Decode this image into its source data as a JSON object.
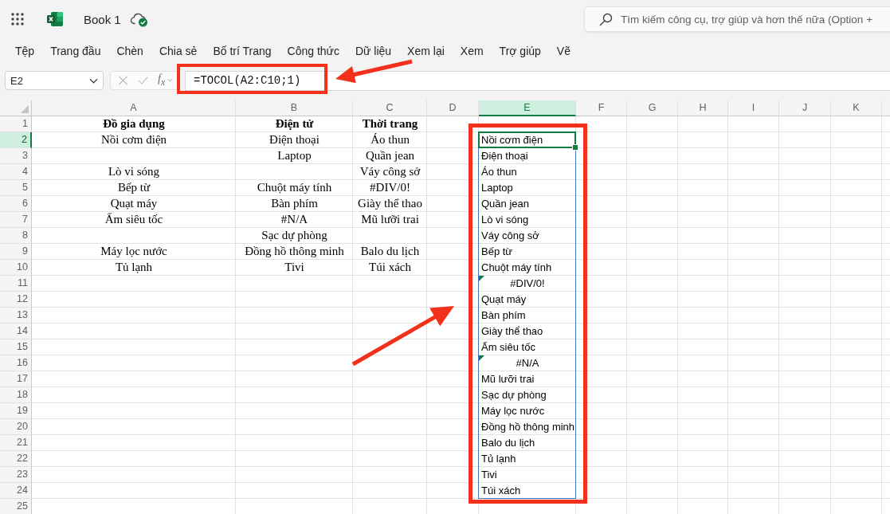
{
  "app_bar": {
    "title": "Book 1"
  },
  "search": {
    "placeholder": "Tìm kiếm công cụ, trợ giúp và hơn thế nữa (Option +"
  },
  "menu": [
    "Tệp",
    "Trang đầu",
    "Chèn",
    "Chia sẻ",
    "Bố trí Trang",
    "Công thức",
    "Dữ liệu",
    "Xem lại",
    "Xem",
    "Trợ giúp",
    "Vẽ"
  ],
  "formula_bar": {
    "cell_reference": "E2",
    "function_button": "f$_{x}$",
    "formula": "=TOCOL(A2:C10;1)",
    "highlighted": true
  },
  "sheet": {
    "columns": [
      {
        "label": "A",
        "selected": false,
        "highlighted": false
      },
      {
        "label": "B",
        "selected": false,
        "highlighted": false
      },
      {
        "label": "C",
        "selected": false,
        "highlighted": false
      },
      {
        "label": "D",
        "selected": false,
        "highlighted": false
      },
      {
        "label": "E",
        "selected": true,
        "highlighted": true
      },
      {
        "label": "F",
        "selected": false,
        "highlighted": false
      },
      {
        "label": "G",
        "selected": false,
        "highlighted": false
      },
      {
        "label": "H",
        "selected": false,
        "highlighted": false
      },
      {
        "label": "I",
        "selected": false,
        "highlighted": false
      },
      {
        "label": "J",
        "selected": false,
        "highlighted": false
      },
      {
        "label": "K",
        "selected": false,
        "highlighted": false
      }
    ],
    "rows": [
      {
        "number": "1",
        "selected": false,
        "cells": {
          "a": {
            "text": "Đồ gia dụng",
            "kind": "heading",
            "selected": false
          },
          "b": {
            "text": "Điện tử",
            "kind": "heading",
            "selected": false
          },
          "c": {
            "text": "Thời trang",
            "kind": "heading",
            "selected": false
          }
        }
      },
      {
        "number": "2",
        "selected": true,
        "cells": {
          "a": {
            "text": "Nồi cơm điện",
            "kind": "value",
            "selected": false
          },
          "b": {
            "text": "Điện thoại",
            "kind": "value",
            "selected": false
          },
          "c": {
            "text": "Áo thun",
            "kind": "value",
            "selected": false
          },
          "e": {
            "text": "Nồi cơm điện",
            "kind": "spill",
            "selected": true
          }
        }
      },
      {
        "number": "3",
        "selected": false,
        "cells": {
          "b": {
            "text": "Laptop",
            "kind": "value",
            "selected": false
          },
          "c": {
            "text": "Quần jean",
            "kind": "value",
            "selected": false
          },
          "e": {
            "text": "Điện thoại",
            "kind": "spill",
            "selected": false
          }
        }
      },
      {
        "number": "4",
        "selected": false,
        "cells": {
          "a": {
            "text": "Lò vi sóng",
            "kind": "value",
            "selected": false
          },
          "c": {
            "text": "Váy công sở",
            "kind": "value",
            "selected": false
          },
          "e": {
            "text": "Áo thun",
            "kind": "spill",
            "selected": false
          }
        }
      },
      {
        "number": "5",
        "selected": false,
        "cells": {
          "a": {
            "text": "Bếp từ",
            "kind": "value",
            "selected": false
          },
          "b": {
            "text": "Chuột máy tính",
            "kind": "value",
            "selected": false
          },
          "c": {
            "text": "#DIV/0!",
            "kind": "value",
            "selected": false
          },
          "e": {
            "text": "Laptop",
            "kind": "spill",
            "selected": false
          }
        }
      },
      {
        "number": "6",
        "selected": false,
        "cells": {
          "a": {
            "text": "Quạt máy",
            "kind": "value",
            "selected": false
          },
          "b": {
            "text": "Bàn phím",
            "kind": "value",
            "selected": false
          },
          "c": {
            "text": "Giày thể thao",
            "kind": "value",
            "selected": false
          },
          "e": {
            "text": "Quần jean",
            "kind": "spill",
            "selected": false
          }
        }
      },
      {
        "number": "7",
        "selected": false,
        "cells": {
          "a": {
            "text": "Ấm siêu tốc",
            "kind": "value",
            "selected": false
          },
          "b": {
            "text": "#N/A",
            "kind": "value",
            "selected": false
          },
          "c": {
            "text": "Mũ lưỡi trai",
            "kind": "value",
            "selected": false
          },
          "e": {
            "text": "Lò vi sóng",
            "kind": "spill",
            "selected": false
          }
        }
      },
      {
        "number": "8",
        "selected": false,
        "cells": {
          "b": {
            "text": "Sạc dự phòng",
            "kind": "value",
            "selected": false
          },
          "e": {
            "text": "Váy công sở",
            "kind": "spill",
            "selected": false
          }
        }
      },
      {
        "number": "9",
        "selected": false,
        "cells": {
          "a": {
            "text": "Máy lọc nước",
            "kind": "value",
            "selected": false
          },
          "b": {
            "text": "Đồng hồ thông minh",
            "kind": "value",
            "selected": false
          },
          "c": {
            "text": "Balo du lịch",
            "kind": "value",
            "selected": false
          },
          "e": {
            "text": "Bếp từ",
            "kind": "spill",
            "selected": false
          }
        }
      },
      {
        "number": "10",
        "selected": false,
        "cells": {
          "a": {
            "text": "Tủ lạnh",
            "kind": "value",
            "selected": false
          },
          "b": {
            "text": "Tivi",
            "kind": "value",
            "selected": false
          },
          "c": {
            "text": "Túi xách",
            "kind": "value",
            "selected": false
          },
          "e": {
            "text": "Chuột máy tính",
            "kind": "spill",
            "selected": false
          }
        }
      },
      {
        "number": "11",
        "selected": false,
        "cells": {
          "e": {
            "text": "#DIV/0!",
            "kind": "spill_error",
            "selected": false
          }
        }
      },
      {
        "number": "12",
        "selected": false,
        "cells": {
          "e": {
            "text": "Quạt máy",
            "kind": "spill",
            "selected": false
          }
        }
      },
      {
        "number": "13",
        "selected": false,
        "cells": {
          "e": {
            "text": "Bàn phím",
            "kind": "spill",
            "selected": false
          }
        }
      },
      {
        "number": "14",
        "selected": false,
        "cells": {
          "e": {
            "text": "Giày thể thao",
            "kind": "spill",
            "selected": false
          }
        }
      },
      {
        "number": "15",
        "selected": false,
        "cells": {
          "e": {
            "text": "Ấm siêu tốc",
            "kind": "spill",
            "selected": false
          }
        }
      },
      {
        "number": "16",
        "selected": false,
        "cells": {
          "e": {
            "text": "#N/A",
            "kind": "spill_error",
            "selected": false
          }
        }
      },
      {
        "number": "17",
        "selected": false,
        "cells": {
          "e": {
            "text": "Mũ lưỡi trai",
            "kind": "spill",
            "selected": false
          }
        }
      },
      {
        "number": "18",
        "selected": false,
        "cells": {
          "e": {
            "text": "Sạc dự phòng",
            "kind": "spill",
            "selected": false
          }
        }
      },
      {
        "number": "19",
        "selected": false,
        "cells": {
          "e": {
            "text": "Máy lọc nước",
            "kind": "spill",
            "selected": false
          }
        }
      },
      {
        "number": "20",
        "selected": false,
        "cells": {
          "e": {
            "text": "Đồng hồ thông minh",
            "kind": "spill",
            "selected": false
          }
        }
      },
      {
        "number": "21",
        "selected": false,
        "cells": {
          "e": {
            "text": "Balo du lịch",
            "kind": "spill",
            "selected": false
          }
        }
      },
      {
        "number": "22",
        "selected": false,
        "cells": {
          "e": {
            "text": "Tủ lạnh",
            "kind": "spill",
            "selected": false
          }
        }
      },
      {
        "number": "23",
        "selected": false,
        "cells": {
          "e": {
            "text": "Tivi",
            "kind": "spill",
            "selected": false
          }
        }
      },
      {
        "number": "24",
        "selected": false,
        "cells": {
          "e": {
            "text": "Túi xách",
            "kind": "spill",
            "selected": false
          }
        }
      },
      {
        "number": "25",
        "selected": false
      }
    ]
  }
}
